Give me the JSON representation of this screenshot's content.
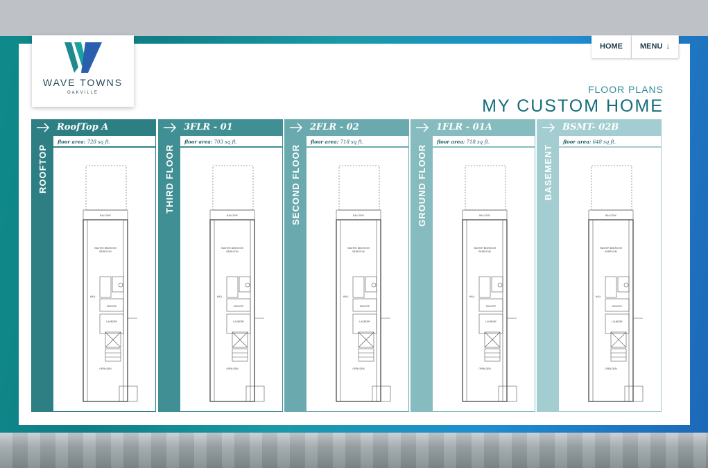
{
  "brand": {
    "name": "WAVE TOWNS",
    "location": "OAKVILLE"
  },
  "nav": {
    "home_label": "HOME",
    "menu_label": "MENU"
  },
  "header": {
    "subtitle": "FLOOR PLANS",
    "title": "MY CUSTOM HOME"
  },
  "area_label": "floor area:",
  "plan_room_labels": {
    "balcony": "BALCONY",
    "master": "MASTER BEDROOM",
    "bedroom": "BEDROOM",
    "ensuite": "ENSUITE",
    "laundry": "LAUNDRY",
    "hall": "HALL",
    "open_den": "OPEN DEN"
  },
  "floors": [
    {
      "plan_name": "RoofTop A",
      "floor_label": "ROOFTOP",
      "area": "728 sq ft.",
      "color": "#2e7f84"
    },
    {
      "plan_name": "3FLR - 01",
      "floor_label": "THIRD FLOOR",
      "area": "703 sq ft.",
      "color": "#3f8f94"
    },
    {
      "plan_name": "2FLR - 02",
      "floor_label": "SECOND FLOOR",
      "area": "718 sq ft.",
      "color": "#6aaaae"
    },
    {
      "plan_name": "1FLR - 01A",
      "floor_label": "GROUND FLOOR",
      "area": "718 sq ft.",
      "color": "#86bcbf"
    },
    {
      "plan_name": "BSMT- 02B",
      "floor_label": "BASEMENT",
      "area": "648 sq ft.",
      "color": "#a3cdd0"
    }
  ]
}
